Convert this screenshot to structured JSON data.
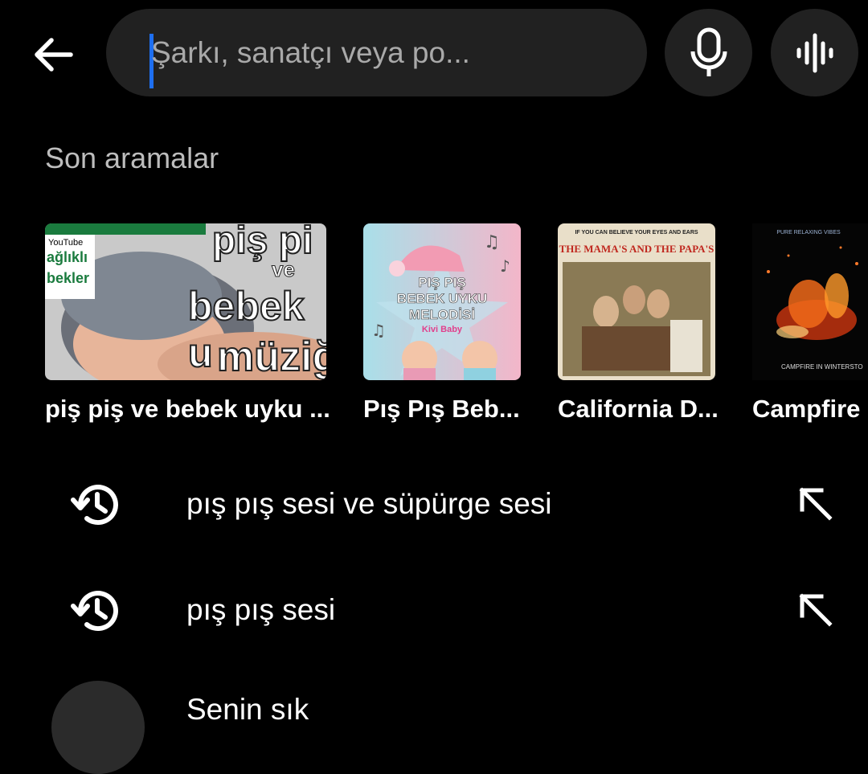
{
  "search": {
    "placeholder": "Şarkı, sanatçı veya po..."
  },
  "recent": {
    "section_title": "Son aramalar",
    "items": [
      {
        "title": "piş piş ve bebek uyku ...",
        "art_text_1": "piş pi",
        "art_text_2": "ve",
        "art_text_3": "bebek u",
        "art_text_4": "müziğ",
        "art_badge_1": "YouTube",
        "art_badge_2": "ağlıklı",
        "art_badge_3": "bekler"
      },
      {
        "title": "Pış Pış Beb...",
        "art_text": "PIŞ PIŞ\nBEBEK UYKU\nMELODİSİ",
        "art_brand": "Kivi Baby"
      },
      {
        "title": "California D...",
        "art_top": "IF YOU CAN BELIEVE YOUR EYES AND EARS",
        "art_band": "THE MAMA'S AND THE PAPA'S"
      },
      {
        "title": "Campfire",
        "art_top": "PURE RELAXING VIBES",
        "art_bottom": "CAMPFIRE IN WINTERSTO"
      }
    ]
  },
  "history": [
    {
      "text": "pış pış sesi ve süpürge sesi"
    },
    {
      "text": "pış pış sesi"
    }
  ],
  "partial": {
    "text": "Senin sık"
  }
}
